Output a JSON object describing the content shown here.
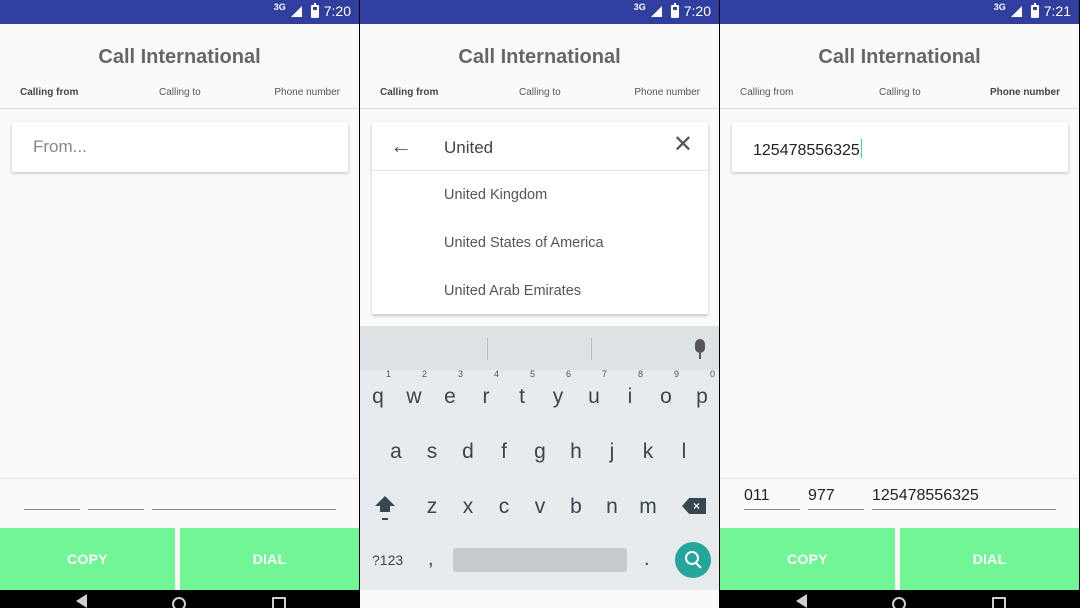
{
  "panels": [
    {
      "status": {
        "network": "3G",
        "time": "7:20"
      },
      "title": "Call International",
      "steps": [
        "Calling from",
        "Calling to",
        "Phone number"
      ],
      "active_step": 0,
      "from_input": {
        "placeholder": "From..."
      },
      "fields": [
        "",
        "",
        ""
      ],
      "buttons": {
        "copy": "COPY",
        "dial": "DIAL"
      }
    },
    {
      "status": {
        "network": "3G",
        "time": "7:20"
      },
      "title": "Call International",
      "steps": [
        "Calling from",
        "Calling to",
        "Phone number"
      ],
      "active_step": 0,
      "search": {
        "value": "United"
      },
      "suggestions": [
        "United Kingdom",
        "United States of America",
        "United Arab Emirates"
      ],
      "keyboard": {
        "row1": [
          "q",
          "w",
          "e",
          "r",
          "t",
          "y",
          "u",
          "i",
          "o",
          "p"
        ],
        "row1_hints": [
          "1",
          "2",
          "3",
          "4",
          "5",
          "6",
          "7",
          "8",
          "9",
          "0"
        ],
        "row2": [
          "a",
          "s",
          "d",
          "f",
          "g",
          "h",
          "j",
          "k",
          "l"
        ],
        "row3": [
          "z",
          "x",
          "c",
          "v",
          "b",
          "n",
          "m"
        ],
        "symbols": "?123",
        "comma": ",",
        "period": "."
      }
    },
    {
      "status": {
        "network": "3G",
        "time": "7:21"
      },
      "title": "Call International",
      "steps": [
        "Calling from",
        "Calling to",
        "Phone number"
      ],
      "active_step": 2,
      "phone_input": {
        "value": "125478556325"
      },
      "fields": [
        "011",
        "977",
        "125478556325"
      ],
      "buttons": {
        "copy": "COPY",
        "dial": "DIAL"
      }
    }
  ],
  "colors": {
    "status_bar": "#303f9f",
    "button": "#71f596",
    "accent_teal": "#26a69a",
    "caret": "#3ddc84"
  },
  "icons": [
    "signal-icon",
    "battery-icon",
    "back-arrow-icon",
    "close-icon",
    "mic-icon",
    "shift-icon",
    "backspace-icon",
    "search-icon",
    "nav-back-icon",
    "nav-home-icon",
    "nav-recent-icon"
  ]
}
